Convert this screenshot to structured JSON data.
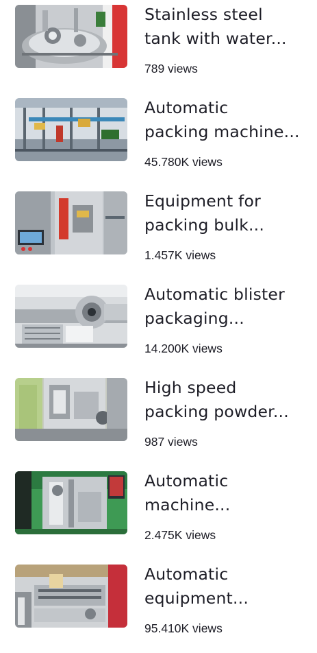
{
  "videos": [
    {
      "title": "Stainless steel\ntank with water...",
      "views": "789 views",
      "thumbnail_icon": "stainless-tank-thumbnail"
    },
    {
      "title": "Automatic\npacking machine...",
      "views": "45.780K views",
      "thumbnail_icon": "packing-machine-thumbnail"
    },
    {
      "title": "Equipment for\npacking bulk...",
      "views": "1.457K views",
      "thumbnail_icon": "bulk-packing-equipment-thumbnail"
    },
    {
      "title": "Automatic blister\npackaging...",
      "views": "14.200K views",
      "thumbnail_icon": "blister-packaging-thumbnail"
    },
    {
      "title": "High speed\npacking powder...",
      "views": "987 views",
      "thumbnail_icon": "powder-packing-thumbnail"
    },
    {
      "title": "Automatic\nmachine...",
      "views": "2.475K views",
      "thumbnail_icon": "automatic-machine-thumbnail"
    },
    {
      "title": "Automatic\nequipment...",
      "views": "95.410K views",
      "thumbnail_icon": "automatic-equipment-thumbnail"
    }
  ]
}
